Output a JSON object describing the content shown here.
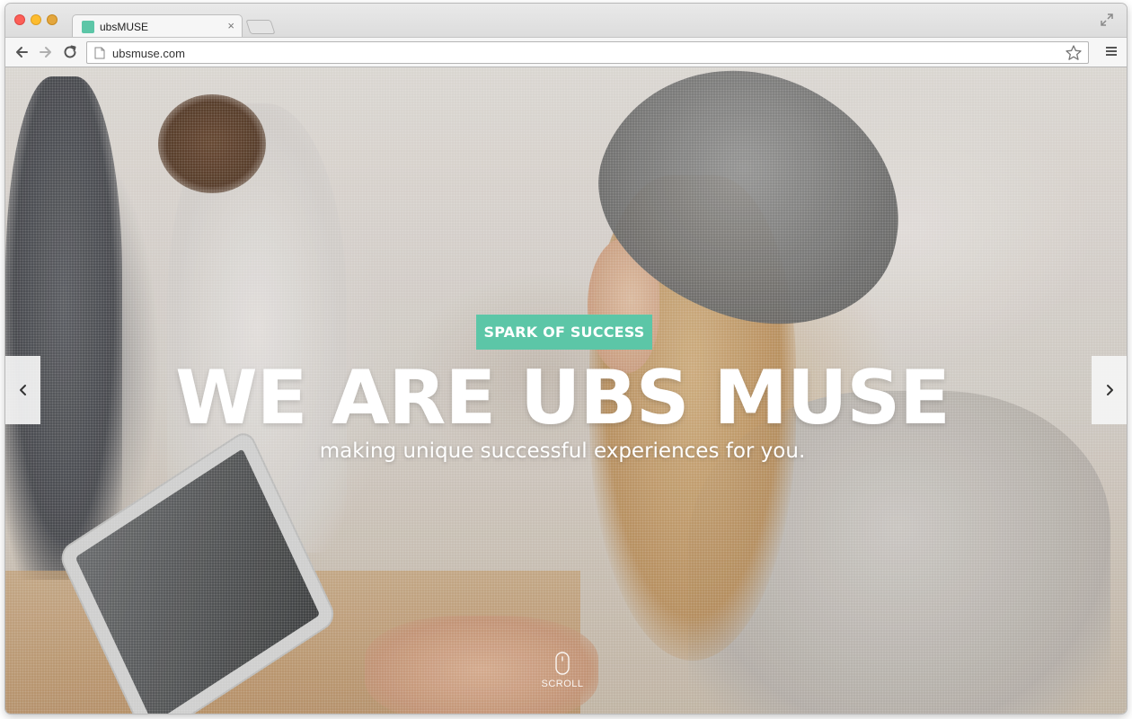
{
  "browser": {
    "tab_title": "ubsMUSE",
    "tab_close": "×",
    "url": "ubsmuse.com",
    "icons": [
      "close-traffic-light",
      "minimize-traffic-light",
      "maximize-traffic-light",
      "back-arrow-icon",
      "forward-arrow-icon",
      "reload-icon",
      "page-icon",
      "star-icon",
      "hamburger-menu-icon",
      "fullscreen-icon"
    ]
  },
  "hero": {
    "badge": "SPARK OF SUCCESS",
    "headline": "WE ARE UBS MUSE",
    "subline": "making unique successful experiences for you.",
    "scroll_label": "SCROLL"
  },
  "colors": {
    "accent": "#5cc6a7",
    "headline": "#ffffff"
  }
}
